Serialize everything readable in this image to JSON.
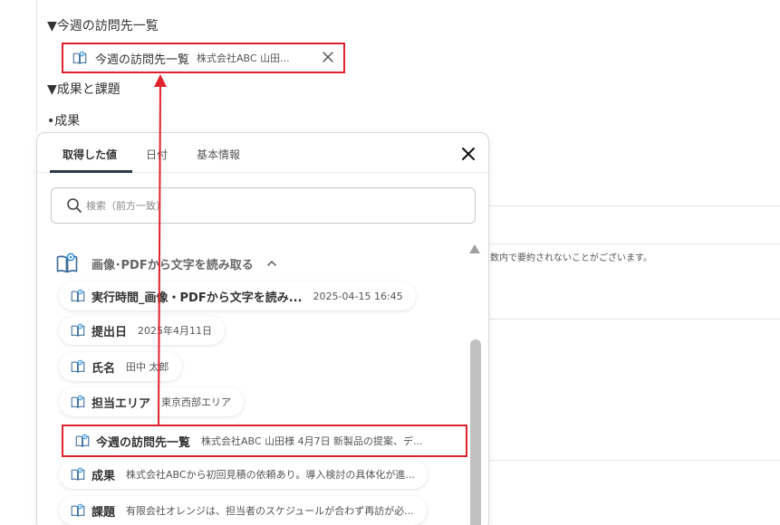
{
  "editor": {
    "heading_visits": "▼今週の訪問先一覧",
    "inserted_pill": {
      "title": "今週の訪問先一覧",
      "value": "株式会社ABC 山田..."
    },
    "heading_results": "▼成果と課題",
    "bullet_results": "•成果",
    "side_note": "数内で要約されないことがございます。"
  },
  "popup": {
    "tabs": [
      {
        "label": "取得した値",
        "active": true
      },
      {
        "label": "日付",
        "active": false
      },
      {
        "label": "基本情報",
        "active": false
      }
    ],
    "search": {
      "placeholder": "検索（前方一致）"
    },
    "section": {
      "title": "画像･PDFから文字を読み取る"
    },
    "items": [
      {
        "label": "実行時間_画像・PDFから文字を読み...",
        "value": "2025-04-15 16:45"
      },
      {
        "label": "提出日",
        "value": "2025年4月11日"
      },
      {
        "label": "氏名",
        "value": "田中 太郎"
      },
      {
        "label": "担当エリア",
        "value": "東京西部エリア"
      },
      {
        "label": "今週の訪問先一覧",
        "value": "株式会社ABC 山田様 4月7日 新製品の提案、デ...",
        "selected": true
      },
      {
        "label": "成果",
        "value": "株式会社ABCから初回見積の依頼あり。導入検討の具体化が進..."
      },
      {
        "label": "課題",
        "value": "有限会社オレンジは、担当者のスケジュールが合わず再訪が必..."
      }
    ]
  },
  "colors": {
    "highlight": "#e0222d",
    "accent": "#2a3a4a",
    "icon": "#2b8fd6"
  }
}
